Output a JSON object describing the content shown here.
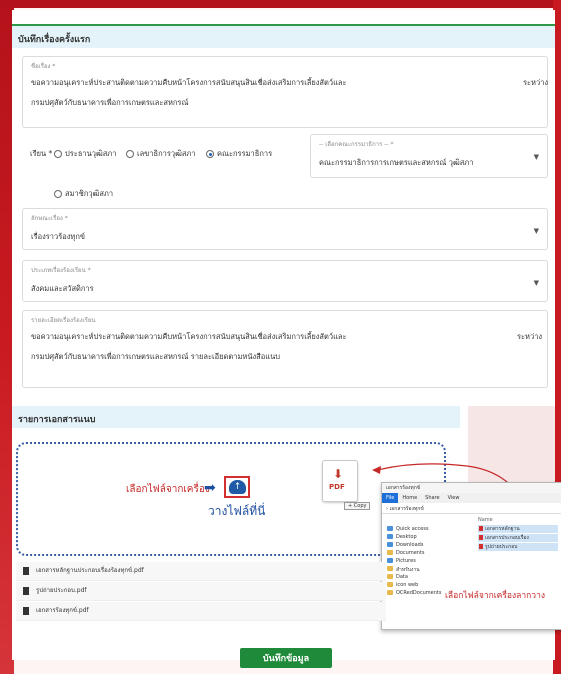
{
  "header": {
    "section1_title": "บันทึกเรื่องครั้งแรก",
    "section2_title": "รายการเอกสารแนบ"
  },
  "form": {
    "subject_label": "ชื่อเรื่อง *",
    "subject_line1": "ขอความอนุเคราะห์ประสานติดตามความคืบหน้าโครงการสนับสนุนสินเชื่อส่งเสริมการเลี้ยงสัตว์และ",
    "subject_right": "ระหว่าง",
    "subject_line2": "กรมปศุสัตว์กับธนาคารเพื่อการเกษตรและสหกรณ์",
    "to_label": "เรียน *",
    "radio_options": [
      "ประธานวุฒิสภา",
      "เลขาธิการวุฒิสภา",
      "คณะกรรมาธิการ",
      "สมาชิกวุฒิสภา"
    ],
    "committee_label": "-- เลือกคณะกรรมาธิการ -- *",
    "committee_value": "คณะกรรมาธิการการเกษตรและสหกรณ์ วุฒิสภา",
    "type_label": "ลักษณะเรื่อง *",
    "type_value": "เรื่องราวร้องทุกข์",
    "category_label": "ประเภทเรื่องร้องเรียน *",
    "category_value": "สังคมและสวัสดิการ",
    "detail_label": "รายละเอียดเรื่องร้องเรียน",
    "detail_line1": "ขอความอนุเคราะห์ประสานติดตามความคืบหน้าโครงการสนับสนุนสินเชื่อส่งเสริมการเลี้ยงสัตว์และ",
    "detail_right": "ระหว่าง",
    "detail_line2": "กรมปศุสัตว์กับธนาคารเพื่อการเกษตรและสหกรณ์ รายละเอียดตามหนังสือแนบ"
  },
  "upload": {
    "select_note": "เลือกไฟล์จากเครื่อง",
    "drop_text": "วางไฟล์ที่นี่",
    "pdf_label": "PDF",
    "copy_label": "+ Copy",
    "explorer_note": "เลือกไฟล์จากเครื่องลากวาง",
    "files": [
      "เอกสารหลักฐานประกอบเรื่องร้องทุกข์.pdf",
      "รูปถ่ายประกอบ.pdf",
      "เอกสารร้องทุกข์.pdf"
    ]
  },
  "explorer": {
    "title": "เอกสารร้องทุกข์",
    "ribbon": [
      "File",
      "Home",
      "Share",
      "View"
    ],
    "path": "›  เอกสารร้องทุกข์",
    "nav": [
      "Quick access",
      "Desktop",
      "Downloads",
      "Documents",
      "Pictures",
      "สำหรับงาน",
      "Data",
      "icon web",
      "OCRedDocuments"
    ],
    "column_header": "Name",
    "files": [
      "เอกสารหลักฐาน",
      "เอกสารประกอบเรื่อง",
      "รูปถ่ายประกอบ"
    ]
  },
  "actions": {
    "save": "บันทึกข้อมูล"
  },
  "colors": {
    "accent_green": "#1e8a3a",
    "frame_red": "#c81a20",
    "link_blue": "#1e4fa0"
  }
}
